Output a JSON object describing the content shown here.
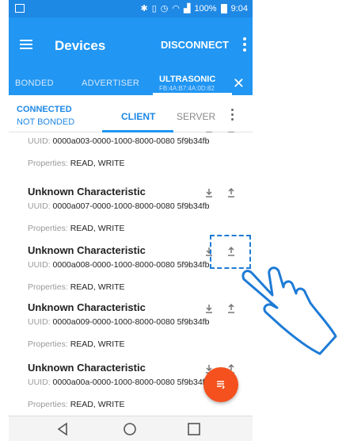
{
  "status_bar": {
    "battery": "100%",
    "time": "9:04"
  },
  "app_bar": {
    "title": "Devices",
    "disconnect_label": "DISCONNECT"
  },
  "device_tabs": {
    "bonded": "BONDED",
    "advertiser": "ADVERTISER",
    "active_name": "ULTRASONIC",
    "active_mac": "FB:4A:B7:4A:0D:82"
  },
  "connection": {
    "state": "CONNECTED",
    "bond": "NOT BONDED"
  },
  "view_tabs": {
    "client": "CLIENT",
    "server": "SERVER"
  },
  "characteristics": [
    {
      "name": "",
      "uuid_label": "UUID:",
      "uuid": "0000a003-0000-1000-8000-0080 5f9b34fb",
      "props_label": "Properties:",
      "props": "READ, WRITE"
    },
    {
      "name": "Unknown Characteristic",
      "uuid_label": "UUID:",
      "uuid": "0000a007-0000-1000-8000-0080 5f9b34fb",
      "props_label": "Properties:",
      "props": "READ, WRITE"
    },
    {
      "name": "Unknown Characteristic",
      "uuid_label": "UUID:",
      "uuid": "0000a008-0000-1000-8000-0080 5f9b34fb",
      "props_label": "Properties:",
      "props": "READ, WRITE"
    },
    {
      "name": "Unknown Characteristic",
      "uuid_label": "UUID:",
      "uuid": "0000a009-0000-1000-8000-0080 5f9b34fb",
      "props_label": "Properties:",
      "props": "READ, WRITE"
    },
    {
      "name": "Unknown Characteristic",
      "uuid_label": "UUID:",
      "uuid": "0000a00a-0000-1000-8000-0080 5f9b34fb",
      "props_label": "Properties:",
      "props": "READ, WRITE"
    }
  ],
  "icons": {
    "read": "download-icon",
    "write": "upload-icon",
    "fab": "log-icon"
  },
  "colors": {
    "primary": "#2196f3",
    "status": "#1e88e5",
    "fab": "#f4511e",
    "highlight": "#1e7bd6"
  }
}
